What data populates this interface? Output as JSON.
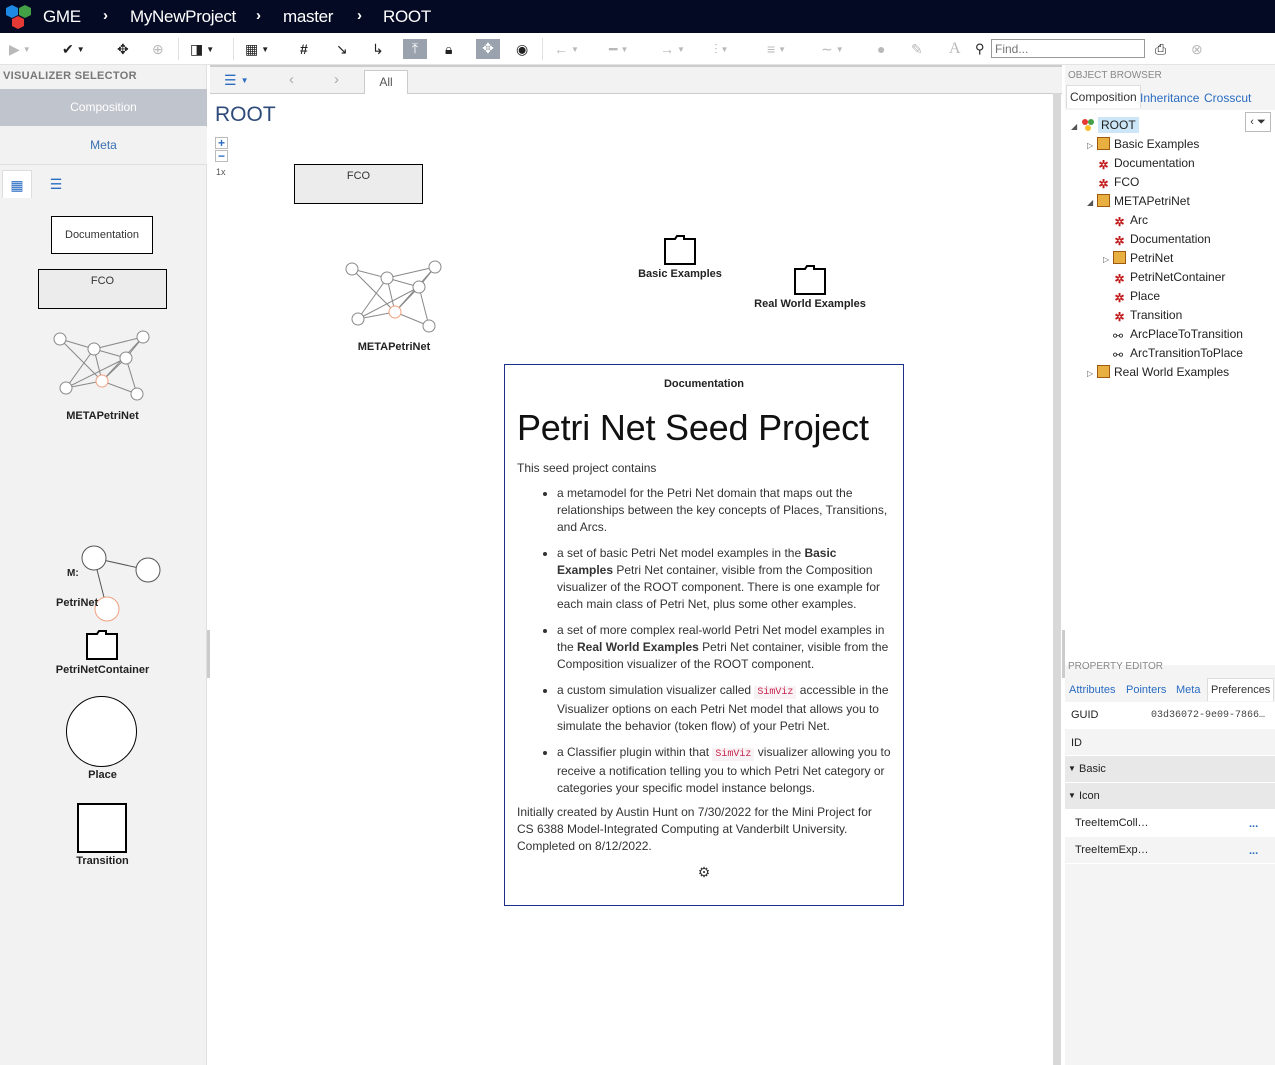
{
  "topbar": {
    "app": "GME",
    "project": "MyNewProject",
    "branch": "master",
    "node": "ROOT"
  },
  "toolbar": {
    "find_placeholder": "Find..."
  },
  "visualizer_selector": {
    "title": "VISUALIZER SELECTOR",
    "items": [
      "Composition",
      "Meta"
    ]
  },
  "palette": {
    "items": [
      "Documentation",
      "FCO",
      "METAPetriNet",
      "M:",
      "PetriNet",
      "PetriNetContainer",
      "Place",
      "Transition"
    ]
  },
  "canvas": {
    "tab_all": "All",
    "title": "ROOT",
    "zoom_level": "1x",
    "nodes": {
      "fco": "FCO",
      "meta": "METAPetriNet",
      "basic": "Basic Examples",
      "realworld": "Real World Examples"
    },
    "doc": {
      "header": "Documentation",
      "heading": "Petri Net Seed Project",
      "intro": "This seed project contains",
      "b1": "a metamodel for the Petri Net domain that maps out the relationships between the key concepts of Places, Transitions, and Arcs.",
      "b2_a": "a set of basic Petri Net model examples in the ",
      "b2_bold": "Basic Examples",
      "b2_b": " Petri Net container, visible from the Composition visualizer of the ROOT component. There is one example for each main class of Petri Net, plus some other examples.",
      "b3_a": "a set of more complex real-world Petri Net model examples in the ",
      "b3_bold": "Real World Examples",
      "b3_b": " Petri Net container, visible from the Composition visualizer of the ROOT component.",
      "b4_a": "a custom simulation visualizer called ",
      "b4_code": "SimViz",
      "b4_b": " accessible in the Visualizer options on each Petri Net model that allows you to simulate the behavior (token flow) of your Petri Net.",
      "b5_a": "a Classifier plugin within that ",
      "b5_code": "SimViz",
      "b5_b": " visualizer allowing you to receive a notification telling you to which Petri Net category or categories your specific model instance belongs.",
      "outro": "Initially created by Austin Hunt on 7/30/2022 for the Mini Project for CS 6388 Model-Integrated Computing at Vanderbilt University. Completed on 8/12/2022."
    }
  },
  "object_browser": {
    "title": "OBJECT BROWSER",
    "tabs": [
      "Composition",
      "Inheritance",
      "Crosscut"
    ],
    "tree": [
      {
        "label": "ROOT",
        "level": 0,
        "toggle": "expanded",
        "icon": "root"
      },
      {
        "label": "Basic Examples",
        "level": 1,
        "toggle": "collapsed",
        "icon": "box"
      },
      {
        "label": "Documentation",
        "level": 1,
        "toggle": "none",
        "icon": "x"
      },
      {
        "label": "FCO",
        "level": 1,
        "toggle": "none",
        "icon": "x"
      },
      {
        "label": "METAPetriNet",
        "level": 1,
        "toggle": "expanded",
        "icon": "box"
      },
      {
        "label": "Arc",
        "level": 2,
        "toggle": "none",
        "icon": "x"
      },
      {
        "label": "Documentation",
        "level": 2,
        "toggle": "none",
        "icon": "x"
      },
      {
        "label": "PetriNet",
        "level": 2,
        "toggle": "collapsed",
        "icon": "box"
      },
      {
        "label": "PetriNetContainer",
        "level": 2,
        "toggle": "none",
        "icon": "x"
      },
      {
        "label": "Place",
        "level": 2,
        "toggle": "none",
        "icon": "x"
      },
      {
        "label": "Transition",
        "level": 2,
        "toggle": "none",
        "icon": "x"
      },
      {
        "label": "ArcPlaceToTransition",
        "level": 2,
        "toggle": "none",
        "icon": "conn"
      },
      {
        "label": "ArcTransitionToPlace",
        "level": 2,
        "toggle": "none",
        "icon": "conn"
      },
      {
        "label": "Real World Examples",
        "level": 1,
        "toggle": "collapsed",
        "icon": "box"
      }
    ]
  },
  "property_editor": {
    "title": "PROPERTY EDITOR",
    "tabs": [
      "Attributes",
      "Pointers",
      "Meta",
      "Preferences"
    ],
    "guid_label": "GUID",
    "guid_value": "03d36072-9e09-7866…",
    "id_label": "ID",
    "group_basic": "Basic",
    "group_icon": "Icon",
    "row1": "TreeItemColl…",
    "row2": "TreeItemExp…",
    "more": "..."
  }
}
